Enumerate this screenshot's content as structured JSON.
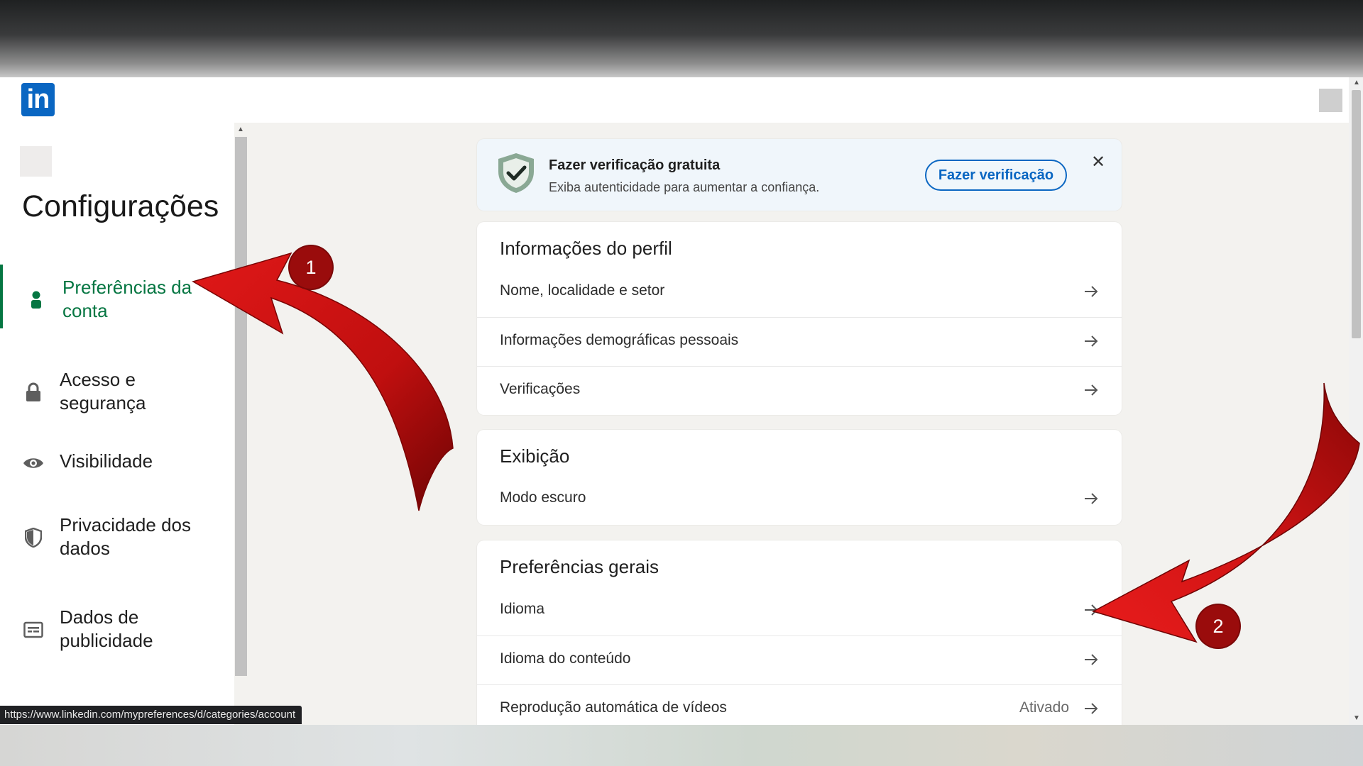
{
  "header": {
    "logo_text": "in"
  },
  "sidebar": {
    "title": "Configurações",
    "items": [
      {
        "label": "Preferências da conta",
        "icon": "person-icon",
        "active": true
      },
      {
        "label": "Acesso e segurança",
        "icon": "lock-icon",
        "active": false
      },
      {
        "label": "Visibilidade",
        "icon": "eye-icon",
        "active": false
      },
      {
        "label": "Privacidade dos dados",
        "icon": "shield-icon",
        "active": false
      },
      {
        "label": "Dados de publicidade",
        "icon": "ad-data-icon",
        "active": false
      }
    ]
  },
  "verification_banner": {
    "title": "Fazer verificação gratuita",
    "subtitle": "Exiba autenticidade para aumentar a confiança.",
    "button_label": "Fazer verificação",
    "close_icon": "close-icon"
  },
  "sections": [
    {
      "title": "Informações do perfil",
      "rows": [
        {
          "label": "Nome, localidade e setor"
        },
        {
          "label": "Informações demográficas pessoais"
        },
        {
          "label": "Verificações"
        }
      ]
    },
    {
      "title": "Exibição",
      "rows": [
        {
          "label": "Modo escuro"
        }
      ]
    },
    {
      "title": "Preferências gerais",
      "rows": [
        {
          "label": "Idioma"
        },
        {
          "label": "Idioma do conteúdo"
        },
        {
          "label": "Reprodução automática de vídeos",
          "value": "Ativado"
        }
      ]
    }
  ],
  "status_bar": {
    "url": "https://www.linkedin.com/mypreferences/d/categories/account"
  },
  "annotations": {
    "badge_1": "1",
    "badge_2": "2",
    "arrow_color": "#c81010"
  },
  "colors": {
    "brand_blue": "#0a66c2",
    "active_green": "#057642",
    "badge_red": "#9a0c0c"
  }
}
